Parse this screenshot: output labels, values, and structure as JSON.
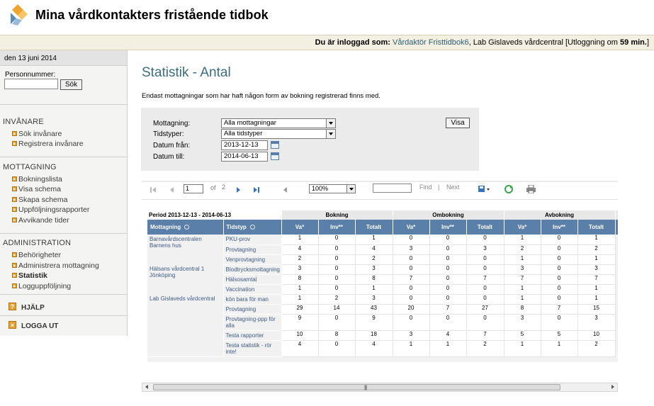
{
  "app": {
    "title": "Mina vårdkontakters fristående tidbok"
  },
  "login": {
    "label": "Du är inloggad som:",
    "user": "Vårdaktör Fristtidbok6",
    "unit": ", Lab Gislaveds vårdcentral [Utloggning om",
    "minutes": "59 min.",
    "close": "]"
  },
  "sidebar": {
    "date": "den 13 juni 2014",
    "personnummer_label": "Personnummer:",
    "search_button": "Sök",
    "invanare": {
      "heading": "INVÅNARE",
      "items": [
        "Sök invånare",
        "Registrera invånare"
      ]
    },
    "mottagning": {
      "heading": "MOTTAGNING",
      "items": [
        "Bokningslista",
        "Visa schema",
        "Skapa schema",
        "Uppföljningsrapporter",
        "Avvikande tider"
      ]
    },
    "administration": {
      "heading": "ADMINISTRATION",
      "items": [
        "Behörigheter",
        "Administrera mottagning",
        "Statistik",
        "Logguppföljning"
      ],
      "active": "Statistik"
    },
    "help": "HJÄLP",
    "logout": "LOGGA UT"
  },
  "main": {
    "title": "Statistik - Antal",
    "intro": "Endast mottagningar som har haft någon form av bokning registrerad finns med.",
    "filters": {
      "mottagning_label": "Mottagning:",
      "mottagning_value": "Alla mottagningar",
      "tidstyper_label": "Tidstyper:",
      "tidstyper_value": "Alla tidstyper",
      "datum_fran_label": "Datum från:",
      "datum_fran_value": "2013-12-13",
      "datum_till_label": "Datum till:",
      "datum_till_value": "2014-06-13",
      "show_button": "Visa"
    },
    "toolbar": {
      "page_value": "1",
      "of_label": "of",
      "total_pages": "2",
      "zoom": "100%",
      "find_label": "Find",
      "separator": "|",
      "next_label": "Next"
    },
    "report": {
      "period": "Period 2013-12-13  -  2014-06-13",
      "groups": [
        "Bokning",
        "Ombokning",
        "Avbokning"
      ],
      "headers": [
        "Mottagning",
        "Tidstyp",
        "Va*",
        "Inv**",
        "Totalt",
        "Va*",
        "Inv**",
        "Totalt",
        "Va*",
        "Inv**",
        "Totalt"
      ],
      "mottagningar": [
        "Barnavårdscentralen Barnens hus",
        "Hälsans vårdcentral 1 Jönköping",
        "Lab Gislaveds vårdcentral"
      ],
      "rows": [
        [
          "PKU-prov",
          "1",
          "0",
          "1",
          "0",
          "0",
          "0",
          "1",
          "0",
          "1"
        ],
        [
          "Provtagning",
          "4",
          "0",
          "4",
          "3",
          "0",
          "3",
          "2",
          "0",
          "2"
        ],
        [
          "Venprovtagning",
          "2",
          "0",
          "2",
          "0",
          "0",
          "0",
          "1",
          "0",
          "1"
        ],
        [
          "Blodtrycksmottagning",
          "3",
          "0",
          "3",
          "0",
          "0",
          "0",
          "3",
          "0",
          "3"
        ],
        [
          "Hälsosamtal",
          "8",
          "0",
          "8",
          "7",
          "0",
          "7",
          "7",
          "0",
          "7"
        ],
        [
          "Vaccination",
          "1",
          "0",
          "1",
          "0",
          "0",
          "0",
          "1",
          "0",
          "1"
        ],
        [
          "kön bara för man",
          "1",
          "2",
          "3",
          "0",
          "0",
          "0",
          "1",
          "0",
          "1"
        ],
        [
          "Provtagning",
          "29",
          "14",
          "43",
          "20",
          "7",
          "27",
          "8",
          "7",
          "15"
        ],
        [
          "Provtagning-ppp för alla",
          "9",
          "0",
          "9",
          "0",
          "0",
          "0",
          "3",
          "0",
          "3"
        ],
        [
          "Testa rapporter",
          "10",
          "8",
          "18",
          "3",
          "4",
          "7",
          "5",
          "5",
          "10"
        ],
        [
          "Testa statistik - rör inte!",
          "4",
          "0",
          "4",
          "1",
          "1",
          "2",
          "1",
          "1",
          "2"
        ]
      ]
    }
  },
  "colors": {
    "accent": "#3b6e81",
    "header_blue": "#5a7fa9",
    "bullet_orange": "#e8a02f"
  },
  "icons": [
    "logo-icon",
    "first-page-icon",
    "prev-page-icon",
    "next-page-icon",
    "last-page-icon",
    "back-icon",
    "export-icon",
    "refresh-icon",
    "print-icon",
    "calendar-icon",
    "sort-icon"
  ]
}
